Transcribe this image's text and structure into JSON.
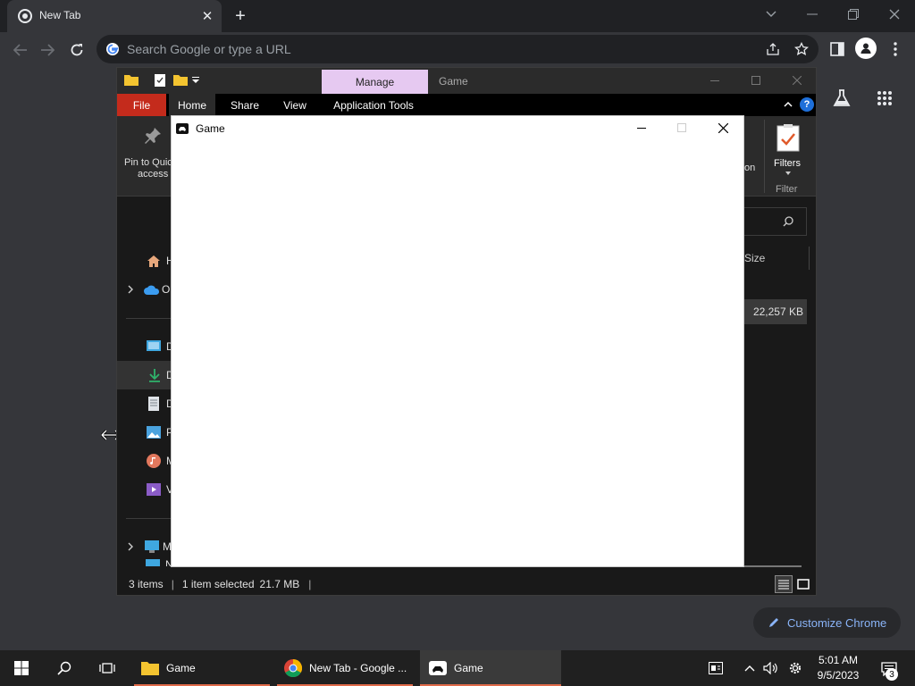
{
  "chrome": {
    "tab_title": "New Tab",
    "omnibox_placeholder": "Search Google or type a URL",
    "customize_label": "Customize Chrome"
  },
  "explorer": {
    "manage_tab": "Manage",
    "window_title": "Game",
    "ribbon_tabs": [
      "File",
      "Home",
      "Share",
      "View",
      "Application Tools"
    ],
    "pin_label_line1": "Pin to Quic",
    "pin_label_line2": "access",
    "right_partial": "on",
    "filters_label": "Filters",
    "filter_group_label": "Filter",
    "col_size": "Size",
    "file_size": "22,257 KB",
    "nav_letters": [
      "H",
      "O",
      "D",
      "D",
      "D",
      "P",
      "M",
      "V",
      "M",
      "Network"
    ],
    "status_items": "3 items",
    "status_selected": "1 item selected",
    "status_size": "21.7 MB"
  },
  "game": {
    "title": "Game"
  },
  "taskbar": {
    "items": [
      {
        "label": "Game"
      },
      {
        "label": "New Tab - Google ..."
      },
      {
        "label": "Game"
      }
    ],
    "time": "5:01 AM",
    "date": "9/5/2023",
    "notification_count": "3"
  },
  "colors": {
    "chrome_bg": "#35363a",
    "explorer_bg": "#191919",
    "manage_tab": "#e6c9f1",
    "file_tab": "#c42b1c",
    "taskbar": "#202020",
    "accent_blue": "#8ab4f8"
  }
}
